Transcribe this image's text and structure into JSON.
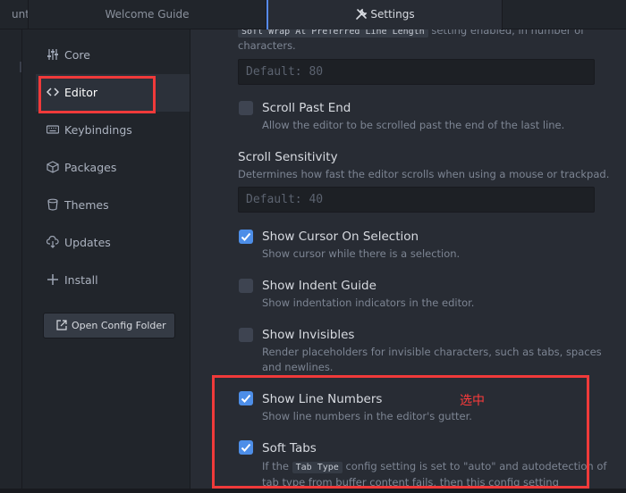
{
  "tabs": [
    {
      "label": "untitled"
    },
    {
      "label": "Welcome Guide"
    },
    {
      "label": "Settings",
      "icon": "settings-tools-icon",
      "active": true
    }
  ],
  "sidebar": {
    "items": [
      {
        "label": "Core",
        "icon": "sliders-icon"
      },
      {
        "label": "Editor",
        "icon": "code-icon",
        "active": true
      },
      {
        "label": "Keybindings",
        "icon": "keyboard-icon"
      },
      {
        "label": "Packages",
        "icon": "package-icon"
      },
      {
        "label": "Themes",
        "icon": "paintcan-icon"
      },
      {
        "label": "Updates",
        "icon": "cloud-download-icon"
      },
      {
        "label": "Install",
        "icon": "plus-icon"
      }
    ],
    "open_config": "Open Config Folder"
  },
  "editor_settings": {
    "soft_wrap_prev": {
      "desc_code": "Soft Wrap At Preferred Line Length",
      "desc_rest_1": " setting enabled, in number of",
      "desc_line_2": "characters.",
      "placeholder": "Default: 80"
    },
    "scroll_past_end": {
      "title": "Scroll Past End",
      "desc": "Allow the editor to be scrolled past the end of the last line.",
      "checked": false
    },
    "scroll_sensitivity": {
      "title": "Scroll Sensitivity",
      "desc": "Determines how fast the editor scrolls when using a mouse or trackpad.",
      "placeholder": "Default: 40"
    },
    "show_cursor_on_selection": {
      "title": "Show Cursor On Selection",
      "desc": "Show cursor while there is a selection.",
      "checked": true
    },
    "show_indent_guide": {
      "title": "Show Indent Guide",
      "desc": "Show indentation indicators in the editor.",
      "checked": false
    },
    "show_invisibles": {
      "title": "Show Invisibles",
      "desc_1": "Render placeholders for invisible characters, such as tabs, spaces",
      "desc_2": "and newlines.",
      "checked": false
    },
    "show_line_numbers": {
      "title": "Show Line Numbers",
      "desc": "Show line numbers in the editor's gutter.",
      "checked": true
    },
    "soft_tabs": {
      "title": "Soft Tabs",
      "desc_pre": "If the ",
      "desc_code": "Tab Type",
      "desc_post": " config setting is set to \"auto\" and autodetection of",
      "desc_2": "tab type from buffer content fails, then this config setting",
      "checked": true
    }
  },
  "annotation": {
    "text": "选中",
    "color": "#ff3b3b"
  },
  "colors": {
    "accent": "#4d8ee8",
    "highlight_box": "#f03a3a",
    "background": "#282c34",
    "sidebar": "#21252b"
  }
}
